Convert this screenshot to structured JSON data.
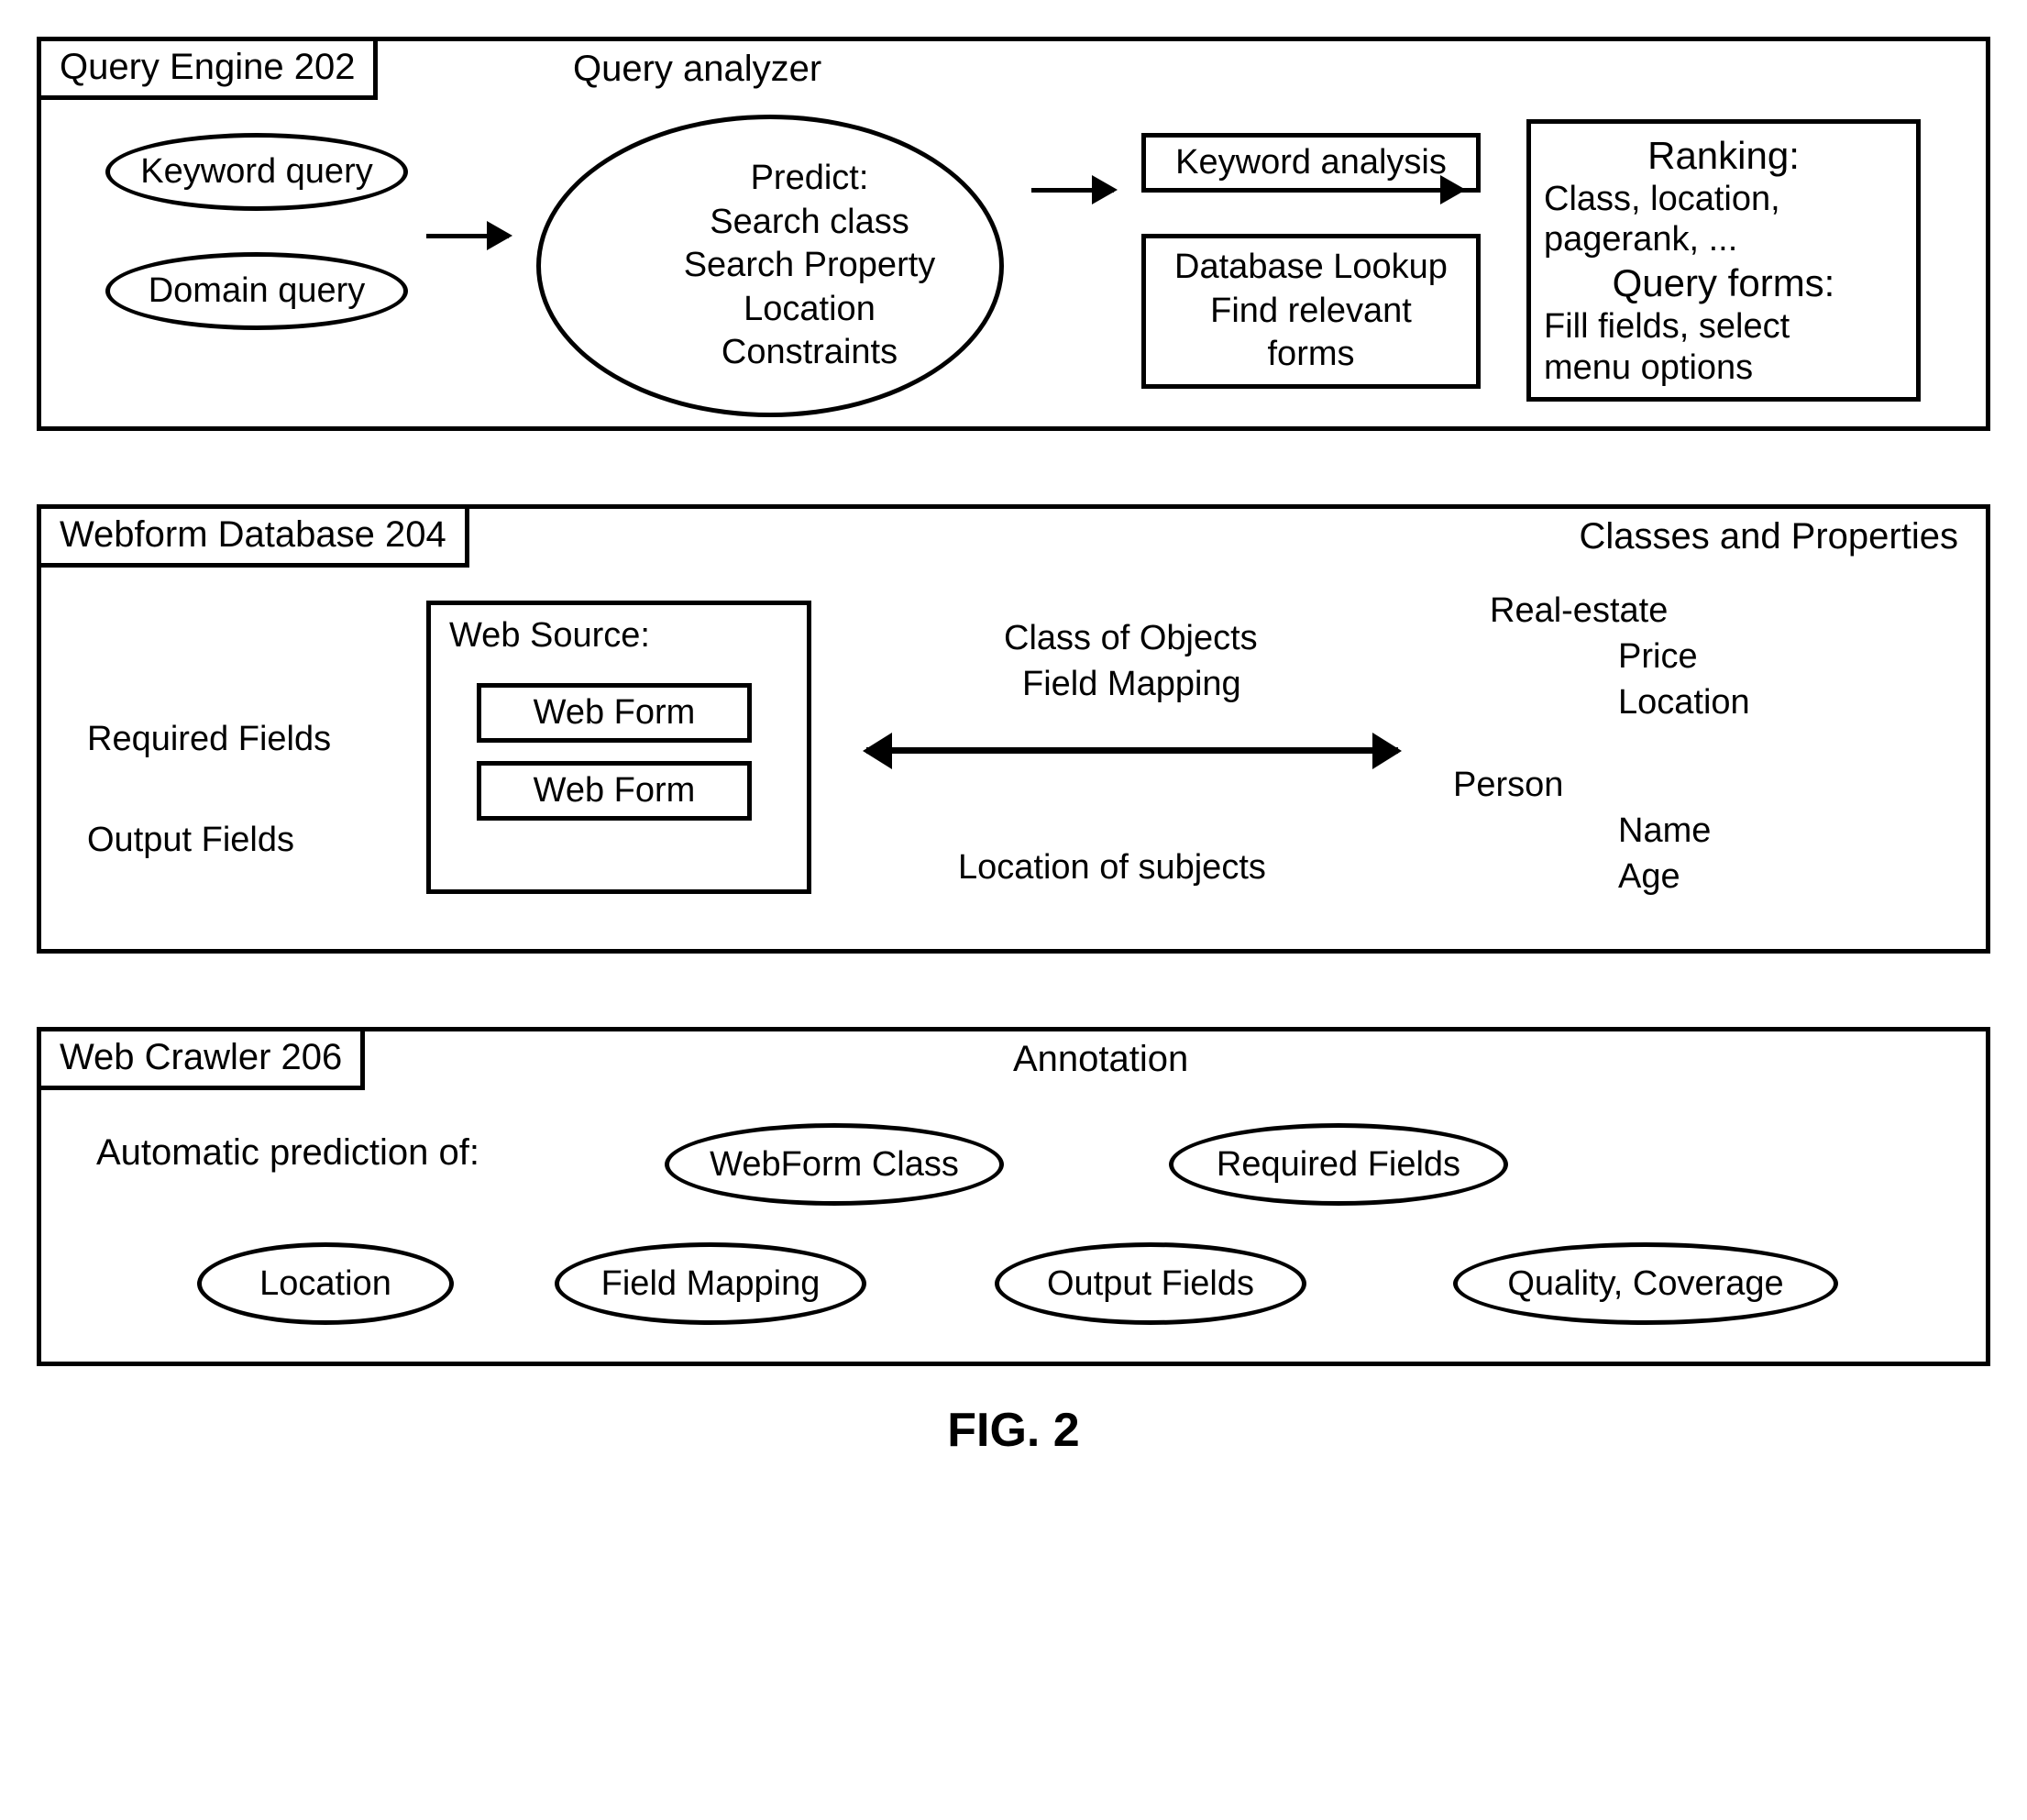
{
  "figure_label": "FIG. 2",
  "panels": {
    "query_engine": {
      "header_left": "Query Engine  202",
      "header_right": "Query analyzer",
      "keyword_query": "Keyword query",
      "domain_query": "Domain query",
      "predict_title": "Predict:",
      "predict_l1": "Search class",
      "predict_l2": "Search Property",
      "predict_l3": "Location",
      "predict_l4": "Constraints",
      "keyword_analysis": "Keyword analysis",
      "db_lookup_l1": "Database Lookup",
      "db_lookup_l2": "Find relevant",
      "db_lookup_l3": "forms",
      "ranking_title": "Ranking:",
      "ranking_l1": "Class, location,",
      "ranking_l2": "pagerank, ...",
      "query_forms_title": "Query forms:",
      "query_forms_l1": "Fill fields, select",
      "query_forms_l2": "menu options"
    },
    "webform_db": {
      "header_left": "Webform Database  204",
      "header_right": "Classes and Properties",
      "required_fields": "Required Fields",
      "output_fields": "Output Fields",
      "web_source": "Web Source:",
      "web_form": "Web Form",
      "class_objects": "Class of Objects",
      "field_mapping": "Field Mapping",
      "location_subjects": "Location of subjects",
      "real_estate": "Real-estate",
      "price": "Price",
      "location": "Location",
      "person": "Person",
      "name": "Name",
      "age": "Age"
    },
    "web_crawler": {
      "header_left": "Web Crawler  206",
      "header_right": "Annotation",
      "auto_predict": "Automatic prediction of:",
      "webform_class": "WebForm Class",
      "required_fields": "Required Fields",
      "location": "Location",
      "field_mapping": "Field Mapping",
      "output_fields": "Output Fields",
      "quality_coverage": "Quality, Coverage"
    }
  }
}
